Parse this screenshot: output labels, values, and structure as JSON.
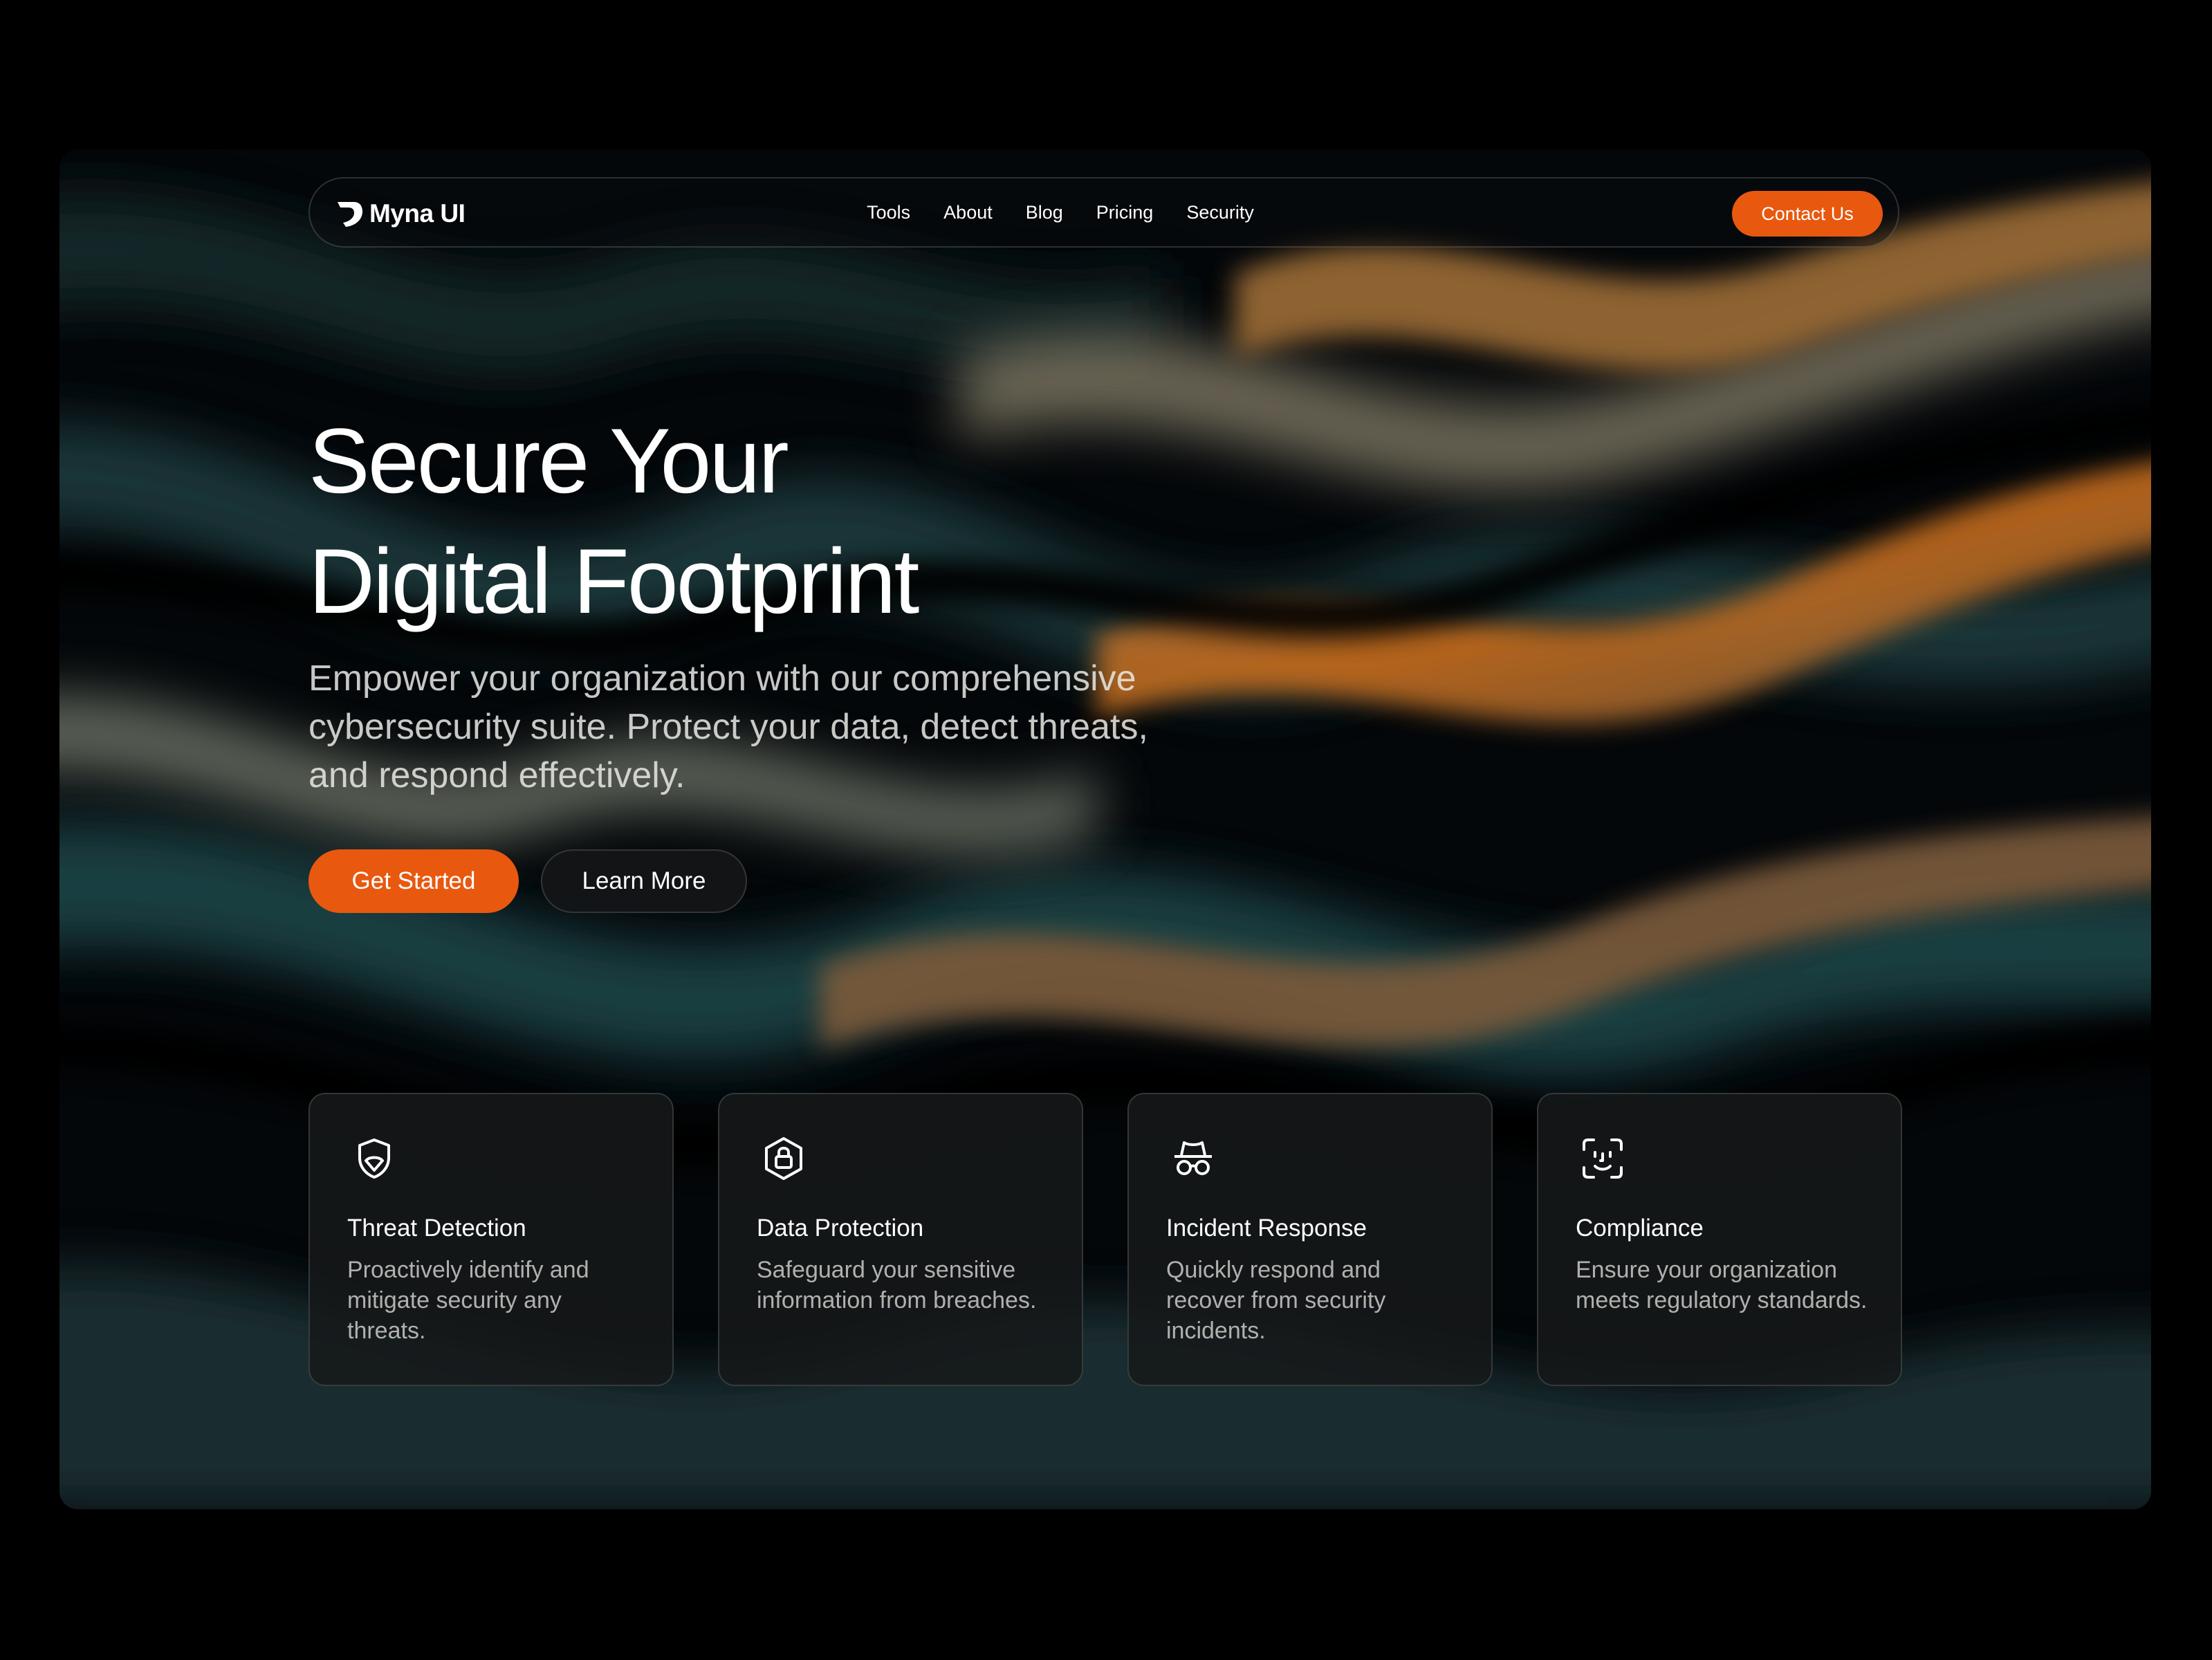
{
  "brand": {
    "name": "Myna UI",
    "accent_color": "#e8580f",
    "logo_icon": "myna-logo-icon"
  },
  "nav": {
    "links": [
      "Tools",
      "About",
      "Blog",
      "Pricing",
      "Security"
    ],
    "contact_label": "Contact Us"
  },
  "hero": {
    "title_line1": "Secure Your",
    "title_line2": "Digital Footprint",
    "subtitle": "Empower your organization with our comprehensive cybersecurity suite. Protect your data, detect threats, and respond effectively.",
    "primary_cta": "Get Started",
    "secondary_cta": "Learn More"
  },
  "features": [
    {
      "icon": "shield-icon",
      "title": "Threat Detection",
      "description": "Proactively identify and mitigate security any threats."
    },
    {
      "icon": "lock-hexagon-icon",
      "title": "Data Protection",
      "description": "Safeguard your sensitive information from breaches."
    },
    {
      "icon": "incognito-icon",
      "title": "Incident Response",
      "description": "Quickly respond and recover from security incidents."
    },
    {
      "icon": "face-scan-icon",
      "title": "Compliance",
      "description": "Ensure your organization meets regulatory standards."
    }
  ]
}
